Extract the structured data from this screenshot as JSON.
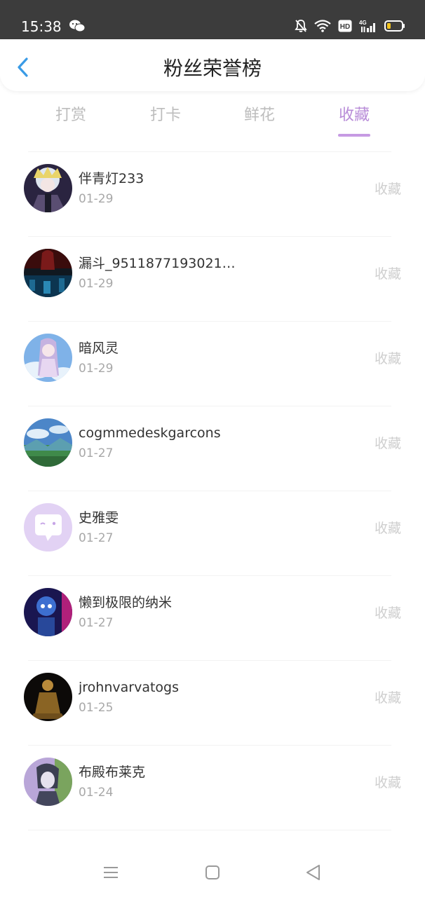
{
  "status_bar": {
    "time": "15:38",
    "network": "4G"
  },
  "header": {
    "title": "粉丝荣誉榜"
  },
  "tabs": [
    {
      "label": "打赏",
      "active": false
    },
    {
      "label": "打卡",
      "active": false
    },
    {
      "label": "鲜花",
      "active": false
    },
    {
      "label": "收藏",
      "active": true
    }
  ],
  "rows": [
    {
      "name": "伴青灯233",
      "date": "01-29",
      "tag": "收藏"
    },
    {
      "name": "漏斗_95118771930213…",
      "date": "01-29",
      "tag": "收藏"
    },
    {
      "name": "暗风灵",
      "date": "01-29",
      "tag": "收藏"
    },
    {
      "name": "cogmmedeskgarcons",
      "date": "01-27",
      "tag": "收藏"
    },
    {
      "name": "史雅雯",
      "date": "01-27",
      "tag": "收藏"
    },
    {
      "name": "懒到极限的纳米",
      "date": "01-27",
      "tag": "收藏"
    },
    {
      "name": "jrohnvarvatogs",
      "date": "01-25",
      "tag": "收藏"
    },
    {
      "name": "布殿布莱克",
      "date": "01-24",
      "tag": "收藏"
    }
  ],
  "colors": {
    "accent": "#b88cd8",
    "status_bar": "#3c3c3c",
    "back_arrow": "#3a9be6"
  }
}
